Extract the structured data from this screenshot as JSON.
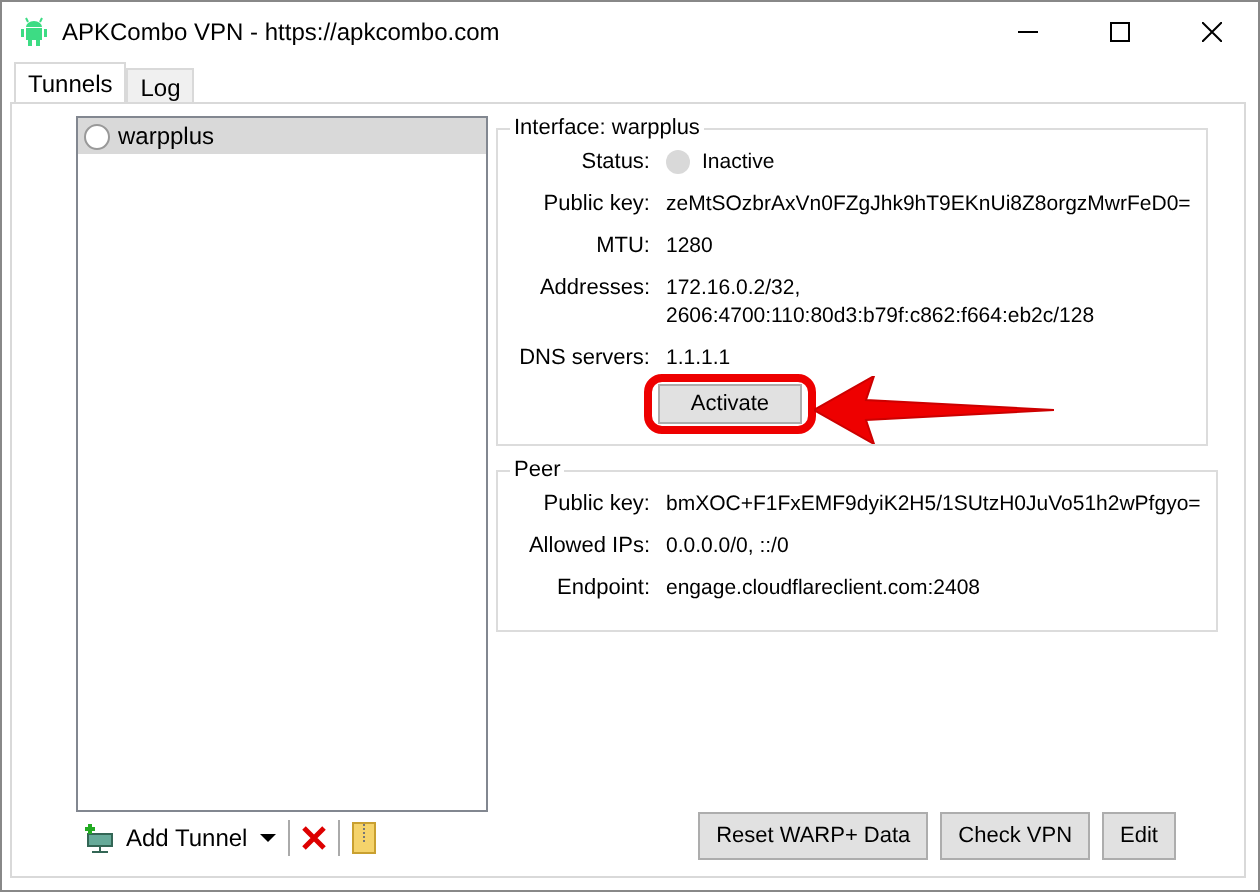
{
  "window": {
    "title": "APKCombo VPN - https://apkcombo.com"
  },
  "tabs": [
    {
      "label": "Tunnels",
      "selected": true
    },
    {
      "label": "Log",
      "selected": false
    }
  ],
  "tunnels": [
    {
      "name": "warpplus",
      "selected": true,
      "active": false
    }
  ],
  "interface": {
    "title": "Interface: warpplus",
    "fields": [
      {
        "kind": "status",
        "label": "Status:",
        "value": "Inactive",
        "active": false
      },
      {
        "kind": "text",
        "label": "Public key:",
        "value": "zeMtSOzbrAxVn0FZgJhk9hT9EKnUi8Z8orgzMwrFeD0="
      },
      {
        "kind": "text",
        "label": "MTU:",
        "value": "1280"
      },
      {
        "kind": "multiline",
        "label": "Addresses:",
        "lines": [
          "172.16.0.2/32,",
          "2606:4700:110:80d3:b79f:c862:f664:eb2c/128"
        ]
      },
      {
        "kind": "text",
        "label": "DNS servers:",
        "value": "1.1.1.1"
      }
    ],
    "button": "Activate"
  },
  "peer": {
    "title": "Peer",
    "fields": [
      {
        "label": "Public key:",
        "value": "bmXOC+F1FxEMF9dyiK2H5/1SUtzH0JuVo51h2wPfgyo="
      },
      {
        "label": "Allowed IPs:",
        "value": "0.0.0.0/0, ::/0"
      },
      {
        "label": "Endpoint:",
        "value": "engage.cloudflareclient.com:2408"
      }
    ]
  },
  "toolbar": {
    "add": "Add Tunnel"
  },
  "buttons": [
    "Reset WARP+ Data",
    "Check VPN",
    "Edit"
  ]
}
